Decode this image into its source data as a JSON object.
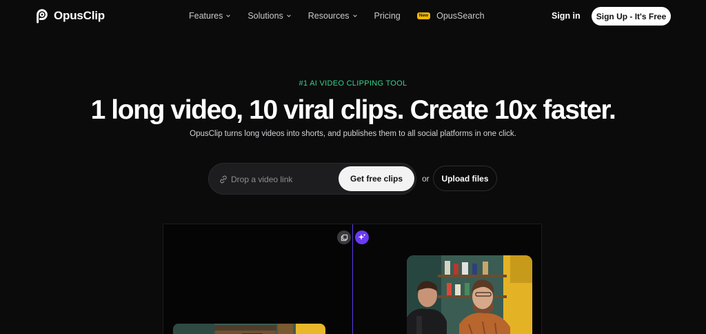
{
  "nav": {
    "logo_text": "OpusClip",
    "menu": [
      {
        "label": "Features",
        "has_dropdown": true
      },
      {
        "label": "Solutions",
        "has_dropdown": true
      },
      {
        "label": "Resources",
        "has_dropdown": true
      },
      {
        "label": "Pricing",
        "has_dropdown": false
      }
    ],
    "opussearch": {
      "badge": "New",
      "label": "OpusSearch"
    },
    "signin_label": "Sign in",
    "signup_label": "Sign Up - It's Free"
  },
  "hero": {
    "eyebrow": "#1 AI VIDEO CLIPPING TOOL",
    "headline": "1 long video, 10 viral clips. Create 10x faster.",
    "subline": "OpusClip turns long videos into shorts, and publishes them to all social platforms in one click.",
    "link_input": {
      "value": "",
      "placeholder": "Drop a video link"
    },
    "get_clips_label": "Get free clips",
    "or_label": "or",
    "upload_label": "Upload files"
  },
  "colors": {
    "background": "#0b0b0c",
    "eyebrow_green": "#34d48a",
    "accent_purple": "#6a3af0",
    "badge_yellow": "#f2b705"
  },
  "icons": {
    "logo": "opusclip-logo-icon",
    "link": "link-icon",
    "copy": "copy-icon",
    "sparkle": "sparkle-icon",
    "chevron": "chevron-down-icon"
  }
}
